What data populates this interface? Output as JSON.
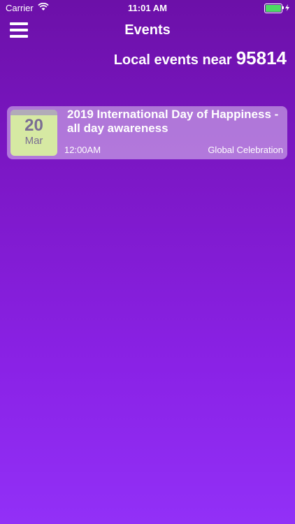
{
  "status_bar": {
    "carrier": "Carrier",
    "time": "11:01 AM",
    "battery_level": 1.0,
    "battery_color": "#4cd964"
  },
  "nav": {
    "title": "Events",
    "menu_icon": "hamburger-icon"
  },
  "location": {
    "prefix": "Local events near",
    "zip": "95814"
  },
  "events": [
    {
      "day": "20",
      "month": "Mar",
      "title": "2019 International Day of Happiness - all day awareness",
      "time": "12:00AM",
      "organizer": "Global Celebration"
    }
  ],
  "colors": {
    "background_top": "#6c10a8",
    "background_bottom": "#9230f7",
    "calendar_bg": "#d6e9a3"
  }
}
